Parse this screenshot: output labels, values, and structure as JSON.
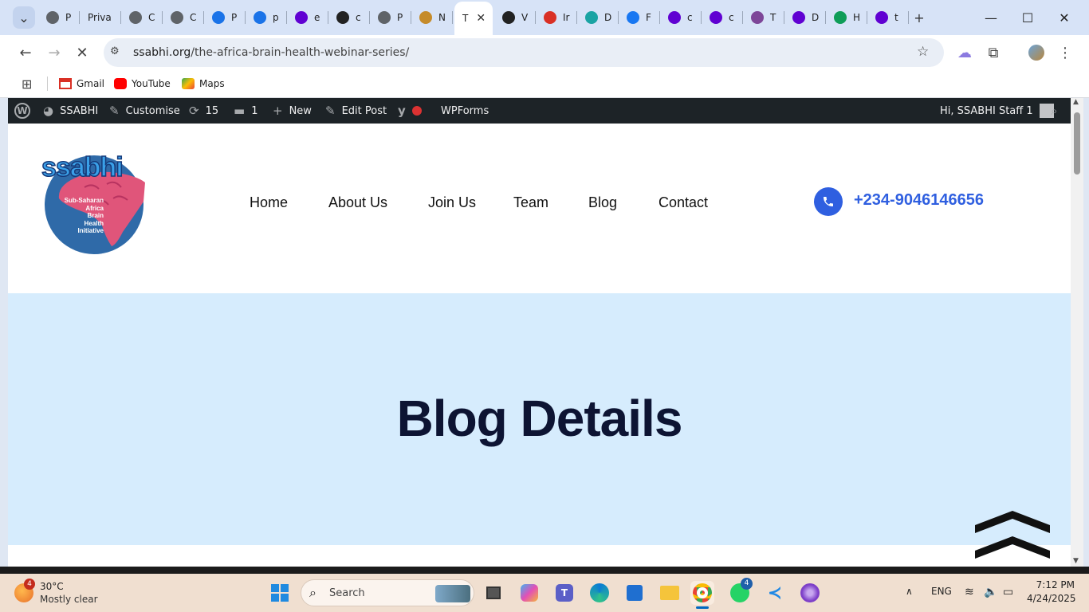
{
  "browser": {
    "tabs": [
      {
        "label": "P",
        "favicon": "globe-icon",
        "color": "#5f6368"
      },
      {
        "label": "Priva",
        "favicon": "none",
        "color": "#5f6368"
      },
      {
        "label": "C",
        "favicon": "globe-icon",
        "color": "#5f6368"
      },
      {
        "label": "C",
        "favicon": "globe-icon",
        "color": "#5f6368"
      },
      {
        "label": "P",
        "favicon": "p-icon",
        "color": "#1a73e8"
      },
      {
        "label": "p",
        "favicon": "p-icon",
        "color": "#1a73e8"
      },
      {
        "label": "e",
        "favicon": "yoast-icon",
        "color": "#6001d2"
      },
      {
        "label": "c",
        "favicon": "github-icon",
        "color": "#222222"
      },
      {
        "label": "P",
        "favicon": "globe-icon",
        "color": "#5f6368"
      },
      {
        "label": "N",
        "favicon": "wand-icon",
        "color": "#c58b2a"
      },
      {
        "label": "T",
        "favicon": "none",
        "color": "#ffffff",
        "active": true
      },
      {
        "label": "V",
        "favicon": "openai-icon",
        "color": "#222222"
      },
      {
        "label": "Ir",
        "favicon": "gmail-icon",
        "color": "#d93025"
      },
      {
        "label": "D",
        "favicon": "cube-icon",
        "color": "#1aa3a3"
      },
      {
        "label": "F",
        "favicon": "facebook-icon",
        "color": "#1877f2"
      },
      {
        "label": "c",
        "favicon": "yoast-icon",
        "color": "#6001d2"
      },
      {
        "label": "c",
        "favicon": "yoast-icon",
        "color": "#6001d2"
      },
      {
        "label": "T",
        "favicon": "tor-icon",
        "color": "#7d4698"
      },
      {
        "label": "D",
        "favicon": "yoast-icon",
        "color": "#6001d2"
      },
      {
        "label": "H",
        "favicon": "sheets-icon",
        "color": "#0f9d58"
      },
      {
        "label": "t",
        "favicon": "yoast-icon",
        "color": "#6001d2"
      }
    ],
    "url_domain": "ssabhi.org",
    "url_path": "/the-africa-brain-health-webinar-series/",
    "bookmarks": [
      {
        "label": "Gmail",
        "icon": "gmail-icon"
      },
      {
        "label": "YouTube",
        "icon": "youtube-icon"
      },
      {
        "label": "Maps",
        "icon": "maps-icon"
      }
    ]
  },
  "adminbar": {
    "site": "SSABHI",
    "customise": "Customise",
    "updates": "15",
    "comments": "1",
    "new": "New",
    "edit_post": "Edit Post",
    "wpforms": "WPForms",
    "greeting": "Hi, SSABHI Staff 1"
  },
  "site": {
    "logo_name": "ssabhi",
    "logo_lines": [
      "Sub-Saharan",
      "Africa",
      "Brain",
      "Health",
      "Initiative"
    ],
    "nav": [
      "Home",
      "About Us",
      "Join Us",
      "Team",
      "Blog",
      "Contact"
    ],
    "phone": "+234-9046146656",
    "hero_title": "Blog Details"
  },
  "taskbar": {
    "weather_temp": "30°C",
    "weather_desc": "Mostly clear",
    "weather_badge": "4",
    "search_placeholder": "Search",
    "whatsapp_badge": "4",
    "lang": "ENG",
    "time": "7:12 PM",
    "date": "4/24/2025"
  }
}
